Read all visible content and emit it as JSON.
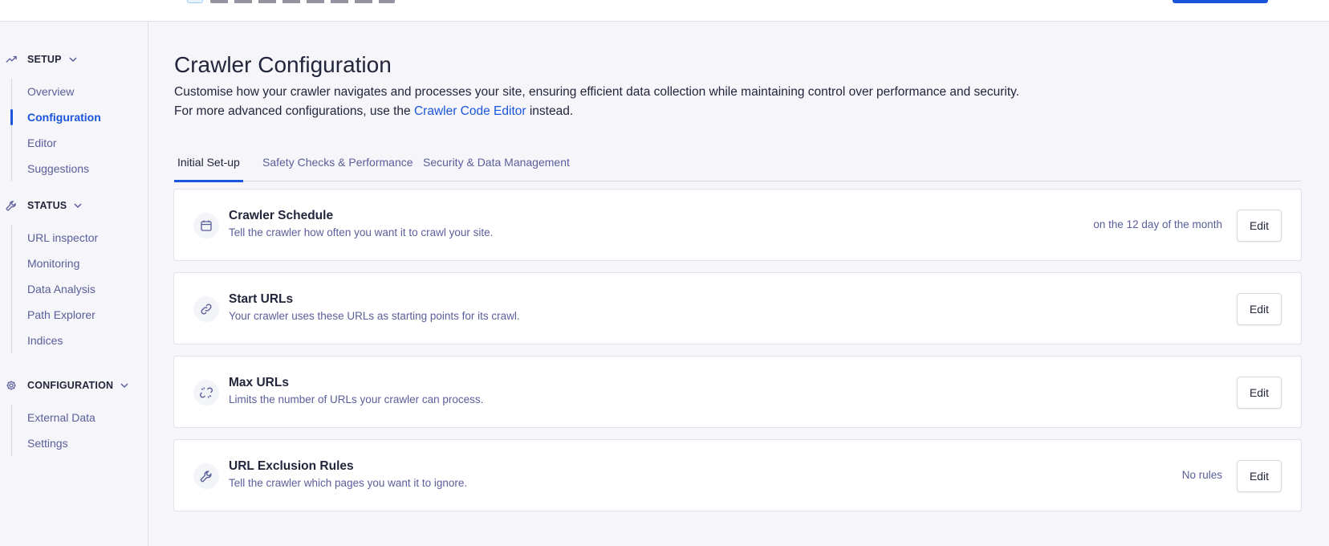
{
  "sidebar": {
    "sections": [
      {
        "title": "SETUP",
        "icon": "trending-up-icon",
        "items": [
          {
            "label": "Overview"
          },
          {
            "label": "Configuration",
            "active": true
          },
          {
            "label": "Editor"
          },
          {
            "label": "Suggestions"
          }
        ]
      },
      {
        "title": "STATUS",
        "icon": "wrench-icon",
        "items": [
          {
            "label": "URL inspector"
          },
          {
            "label": "Monitoring"
          },
          {
            "label": "Data Analysis"
          },
          {
            "label": "Path Explorer"
          },
          {
            "label": "Indices"
          }
        ]
      },
      {
        "title": "CONFIGURATION",
        "icon": "gear-icon",
        "items": [
          {
            "label": "External Data"
          },
          {
            "label": "Settings"
          }
        ]
      }
    ]
  },
  "main": {
    "title": "Crawler Configuration",
    "description_line1": "Customise how your crawler navigates and processes your site, ensuring efficient data collection while maintaining control over performance and security.",
    "description_prefix": "For more advanced configurations, use the",
    "description_link": "Crawler Code Editor",
    "description_suffix": "instead.",
    "tabs": [
      {
        "label": "Initial Set-up",
        "active": true
      },
      {
        "label": "Safety Checks & Performance"
      },
      {
        "label": "Security & Data Management"
      }
    ],
    "cards": [
      {
        "icon": "calendar-icon",
        "title": "Crawler Schedule",
        "subtitle": "Tell the crawler how often you want it to crawl your site.",
        "value": "on the 12 day of the month",
        "button": "Edit"
      },
      {
        "icon": "link-icon",
        "title": "Start URLs",
        "subtitle": "Your crawler uses these URLs as starting points for its crawl.",
        "value": "",
        "button": "Edit"
      },
      {
        "icon": "broken-link-icon",
        "title": "Max URLs",
        "subtitle": "Limits the number of URLs your crawler can process.",
        "value": "",
        "button": "Edit"
      },
      {
        "icon": "wrench-icon",
        "title": "URL Exclusion Rules",
        "subtitle": "Tell the crawler which pages you want it to ignore.",
        "value": "No rules",
        "button": "Edit"
      }
    ]
  },
  "colors": {
    "accent": "#1a56db",
    "text": "#23263b",
    "muted": "#5a5e9a",
    "border": "#e1e2e9",
    "background": "#f5f5fa"
  }
}
